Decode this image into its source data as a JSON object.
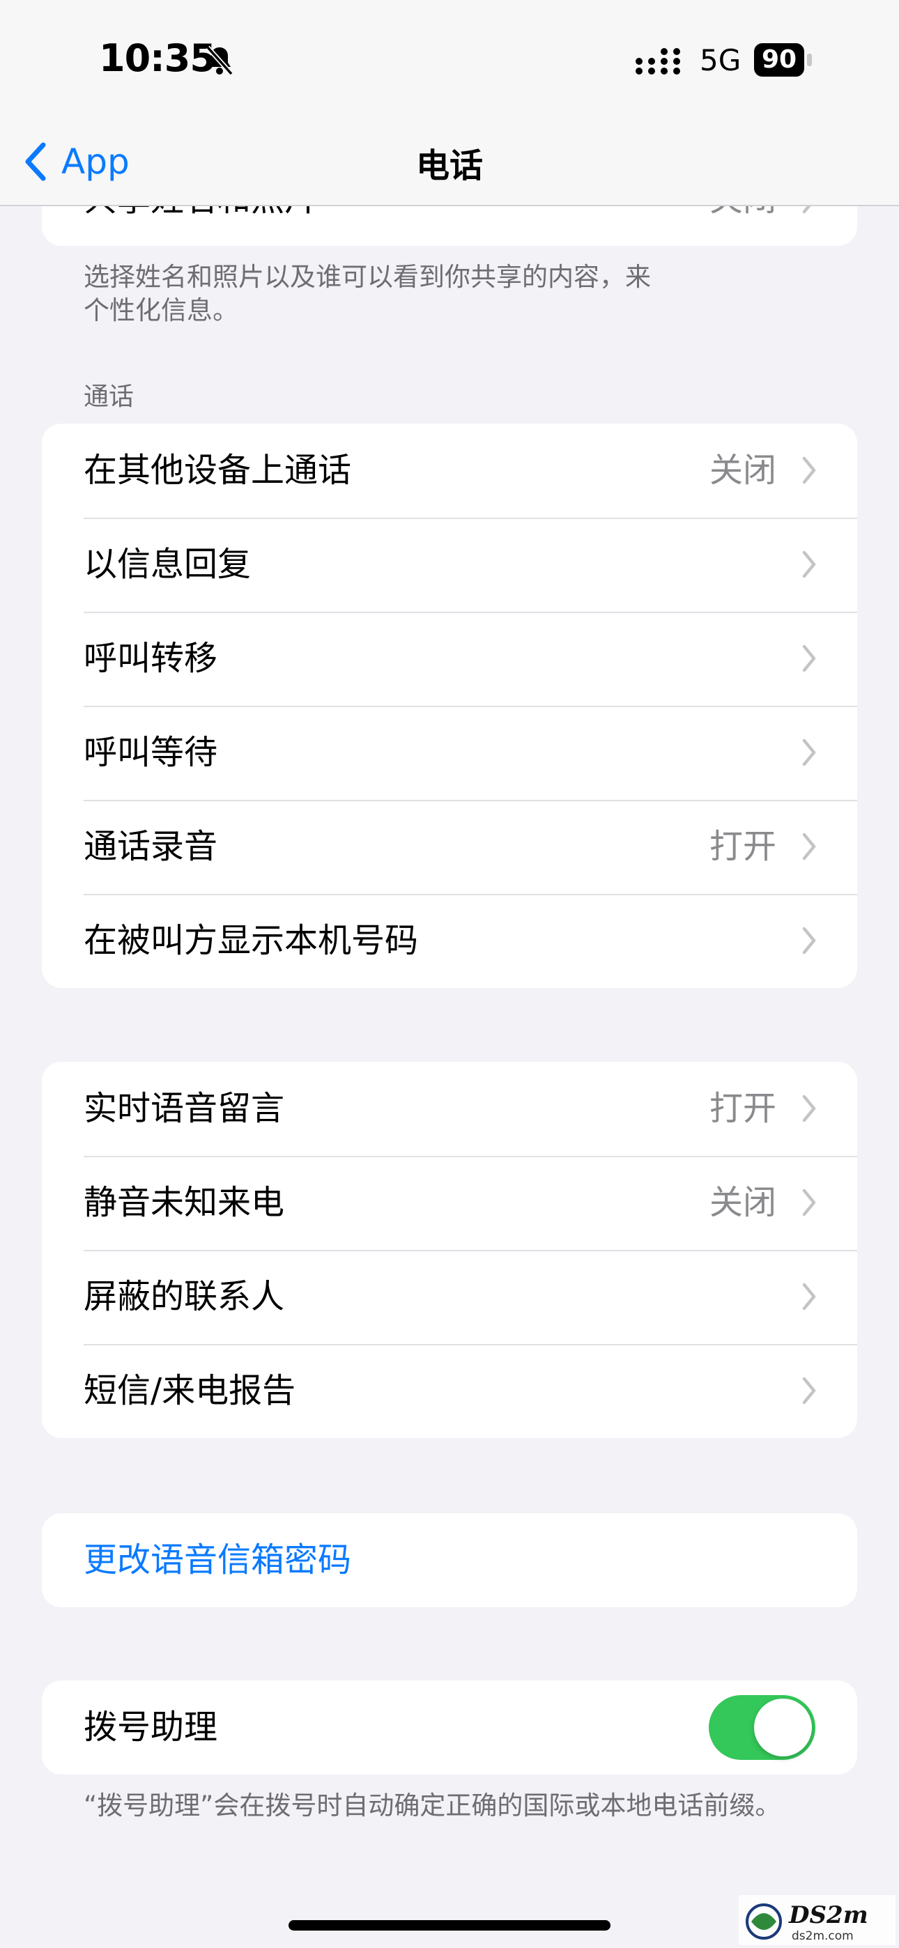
{
  "status": {
    "time": "10:35",
    "network": "5G",
    "battery": "90"
  },
  "nav": {
    "back_label": "App",
    "title": "电话"
  },
  "partial_row": {
    "label": "共享姓名和照片",
    "value": "关闭"
  },
  "partial_footer": "选择姓名和照片以及谁可以看到你共享的内容，来\n个性化信息。",
  "calls_header": "通话",
  "calls_group": [
    {
      "label": "在其他设备上通话",
      "value": "关闭"
    },
    {
      "label": "以信息回复",
      "value": ""
    },
    {
      "label": "呼叫转移",
      "value": ""
    },
    {
      "label": "呼叫等待",
      "value": ""
    },
    {
      "label": "通话录音",
      "value": "打开"
    },
    {
      "label": "在被叫方显示本机号码",
      "value": ""
    }
  ],
  "voicemail_group": [
    {
      "label": "实时语音留言",
      "value": "打开"
    },
    {
      "label": "静音未知来电",
      "value": "关闭"
    },
    {
      "label": "屏蔽的联系人",
      "value": ""
    },
    {
      "label": "短信/来电报告",
      "value": ""
    }
  ],
  "change_password": "更改语音信箱密码",
  "dial_assist": {
    "label": "拨号助理",
    "on": true
  },
  "dial_assist_footer": "“拨号助理”会在拨号时自动确定正确的国际或本地电话前缀。",
  "watermark": {
    "main": "DS2m",
    "sub": "ds2m.com"
  },
  "colors": {
    "accent": "#0a7aff",
    "toggle_on": "#34c759",
    "background": "#f2f2f7"
  }
}
